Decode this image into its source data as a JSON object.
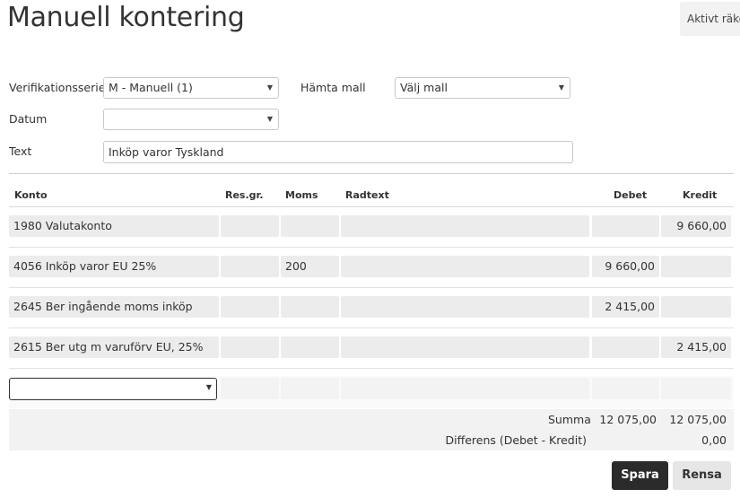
{
  "page": {
    "title": "Manuell kontering",
    "active_label": "Aktivt räke"
  },
  "form": {
    "series_label": "Verifikationsserie",
    "series_value": "M - Manuell (1)",
    "template_label": "Hämta mall",
    "template_value": "Välj mall",
    "date_label": "Datum",
    "date_value": "",
    "text_label": "Text",
    "text_value": "Inköp varor Tyskland"
  },
  "table": {
    "headers": {
      "konto": "Konto",
      "resgr": "Res.gr.",
      "moms": "Moms",
      "radtext": "Radtext",
      "debet": "Debet",
      "kredit": "Kredit"
    },
    "rows": [
      {
        "konto": "1980 Valutakonto",
        "resgr": "",
        "moms": "",
        "radtext": "",
        "debet": "",
        "kredit": "9 660,00"
      },
      {
        "konto": "4056 Inköp varor EU 25%",
        "resgr": "",
        "moms": "200",
        "radtext": "",
        "debet": "9 660,00",
        "kredit": ""
      },
      {
        "konto": "2645 Ber ingående moms inköp",
        "resgr": "",
        "moms": "",
        "radtext": "",
        "debet": "2 415,00",
        "kredit": ""
      },
      {
        "konto": "2615 Ber utg m varuförv EU, 25%",
        "resgr": "",
        "moms": "",
        "radtext": "",
        "debet": "",
        "kredit": "2 415,00"
      }
    ]
  },
  "summary": {
    "summa_label": "Summa",
    "summa_debet": "12 075,00",
    "summa_kredit": "12 075,00",
    "diff_label": "Differens (Debet - Kredit)",
    "diff_value": "0,00"
  },
  "buttons": {
    "save": "Spara",
    "clear": "Rensa"
  },
  "icons": {
    "dropdown": "caret-down-icon"
  }
}
